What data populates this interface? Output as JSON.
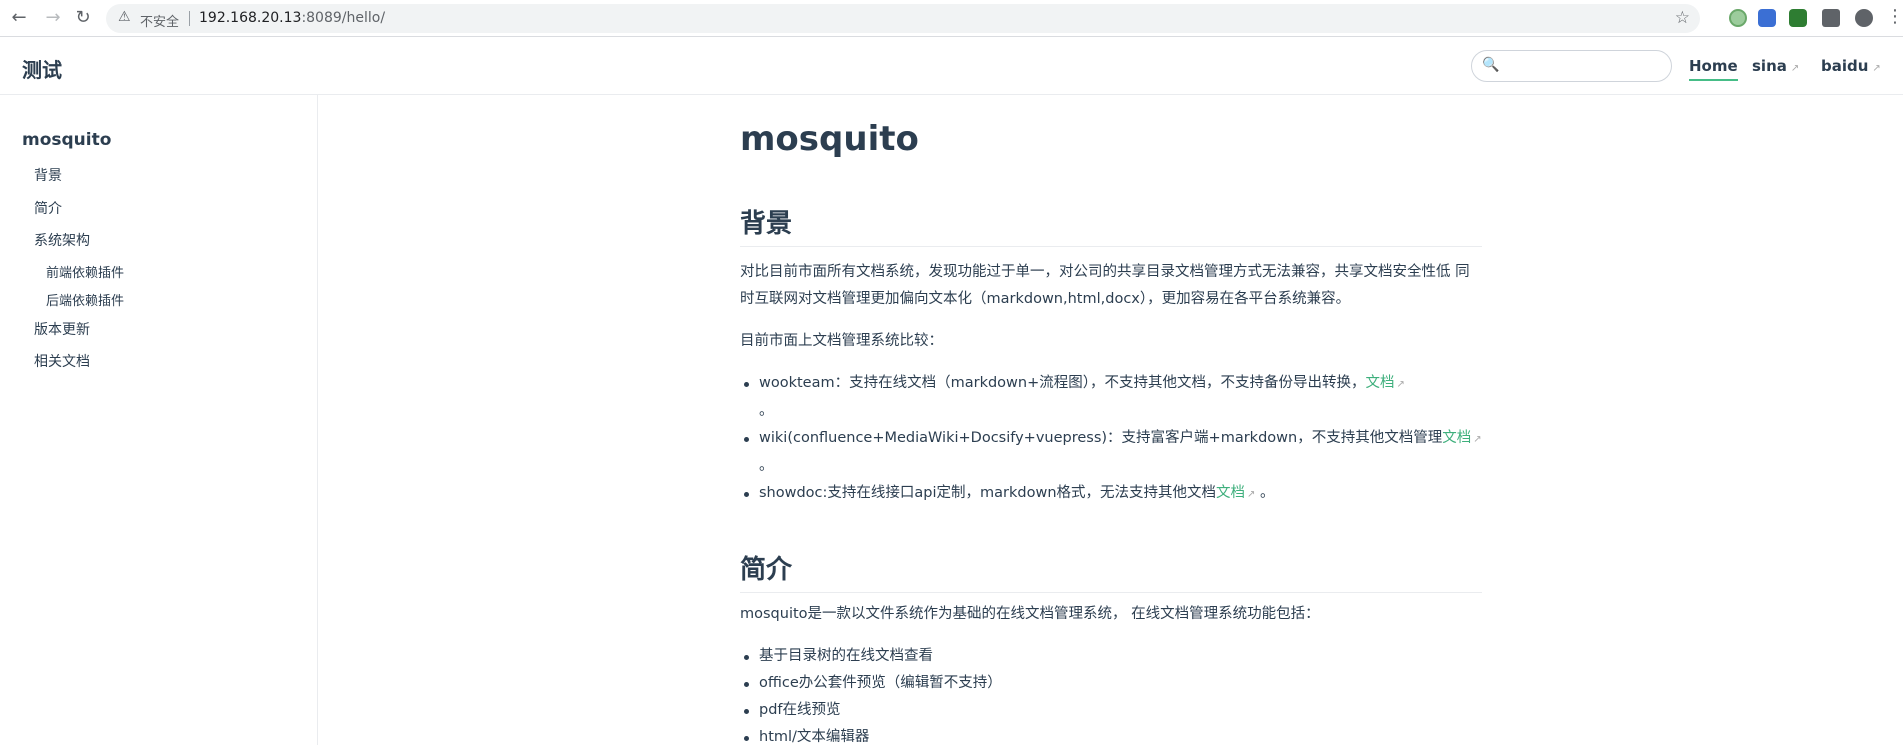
{
  "browser": {
    "insecure_label": "不安全",
    "url_host": "192.168.20.13",
    "url_rest": ":8089/hello/"
  },
  "site": {
    "title": "测试",
    "search_placeholder": "",
    "nav": [
      {
        "label": "Home"
      },
      {
        "label": "sina"
      },
      {
        "label": "baidu"
      }
    ]
  },
  "sidebar": {
    "title": "mosquito",
    "items": [
      {
        "label": "背景"
      },
      {
        "label": "简介"
      },
      {
        "label": "系统架构"
      },
      {
        "label": "前端依赖插件"
      },
      {
        "label": "后端依赖插件"
      },
      {
        "label": "版本更新"
      },
      {
        "label": "相关文档"
      }
    ]
  },
  "content": {
    "h1": "mosquito",
    "bg_heading": "背景",
    "bg_para": "对比目前市面所有文档系统，发现功能过于单一，对公司的共享目录文档管理方式无法兼容，共享文档安全性低 同时互联网对文档管理更加偏向文本化（markdown,html,docx），更加容易在各平台系统兼容。",
    "compare_intro": "目前市面上文档管理系统比较：",
    "compare_items": [
      {
        "text": "wookteam：支持在线文档（markdown+流程图），不支持其他文档，不支持备份导出转换，",
        "link": "文档",
        "tail": "。"
      },
      {
        "text": "wiki(confluence+MediaWiki+Docsify+vuepress)：支持富客户端+markdown，不支持其他文档管理",
        "link": "文档",
        "tail": "。"
      },
      {
        "text": "showdoc:支持在线接口api定制，markdown格式，无法支持其他文档",
        "link": "文档",
        "tail": "。"
      }
    ],
    "intro_heading": "简介",
    "intro_para": "mosquito是一款以文件系统作为基础的在线文档管理系统， 在线文档管理系统功能包括：",
    "features": [
      "基于目录树的在线文档查看",
      "office办公套件预览（编辑暂不支持）",
      "pdf在线预览",
      "html/文本编辑器"
    ]
  }
}
